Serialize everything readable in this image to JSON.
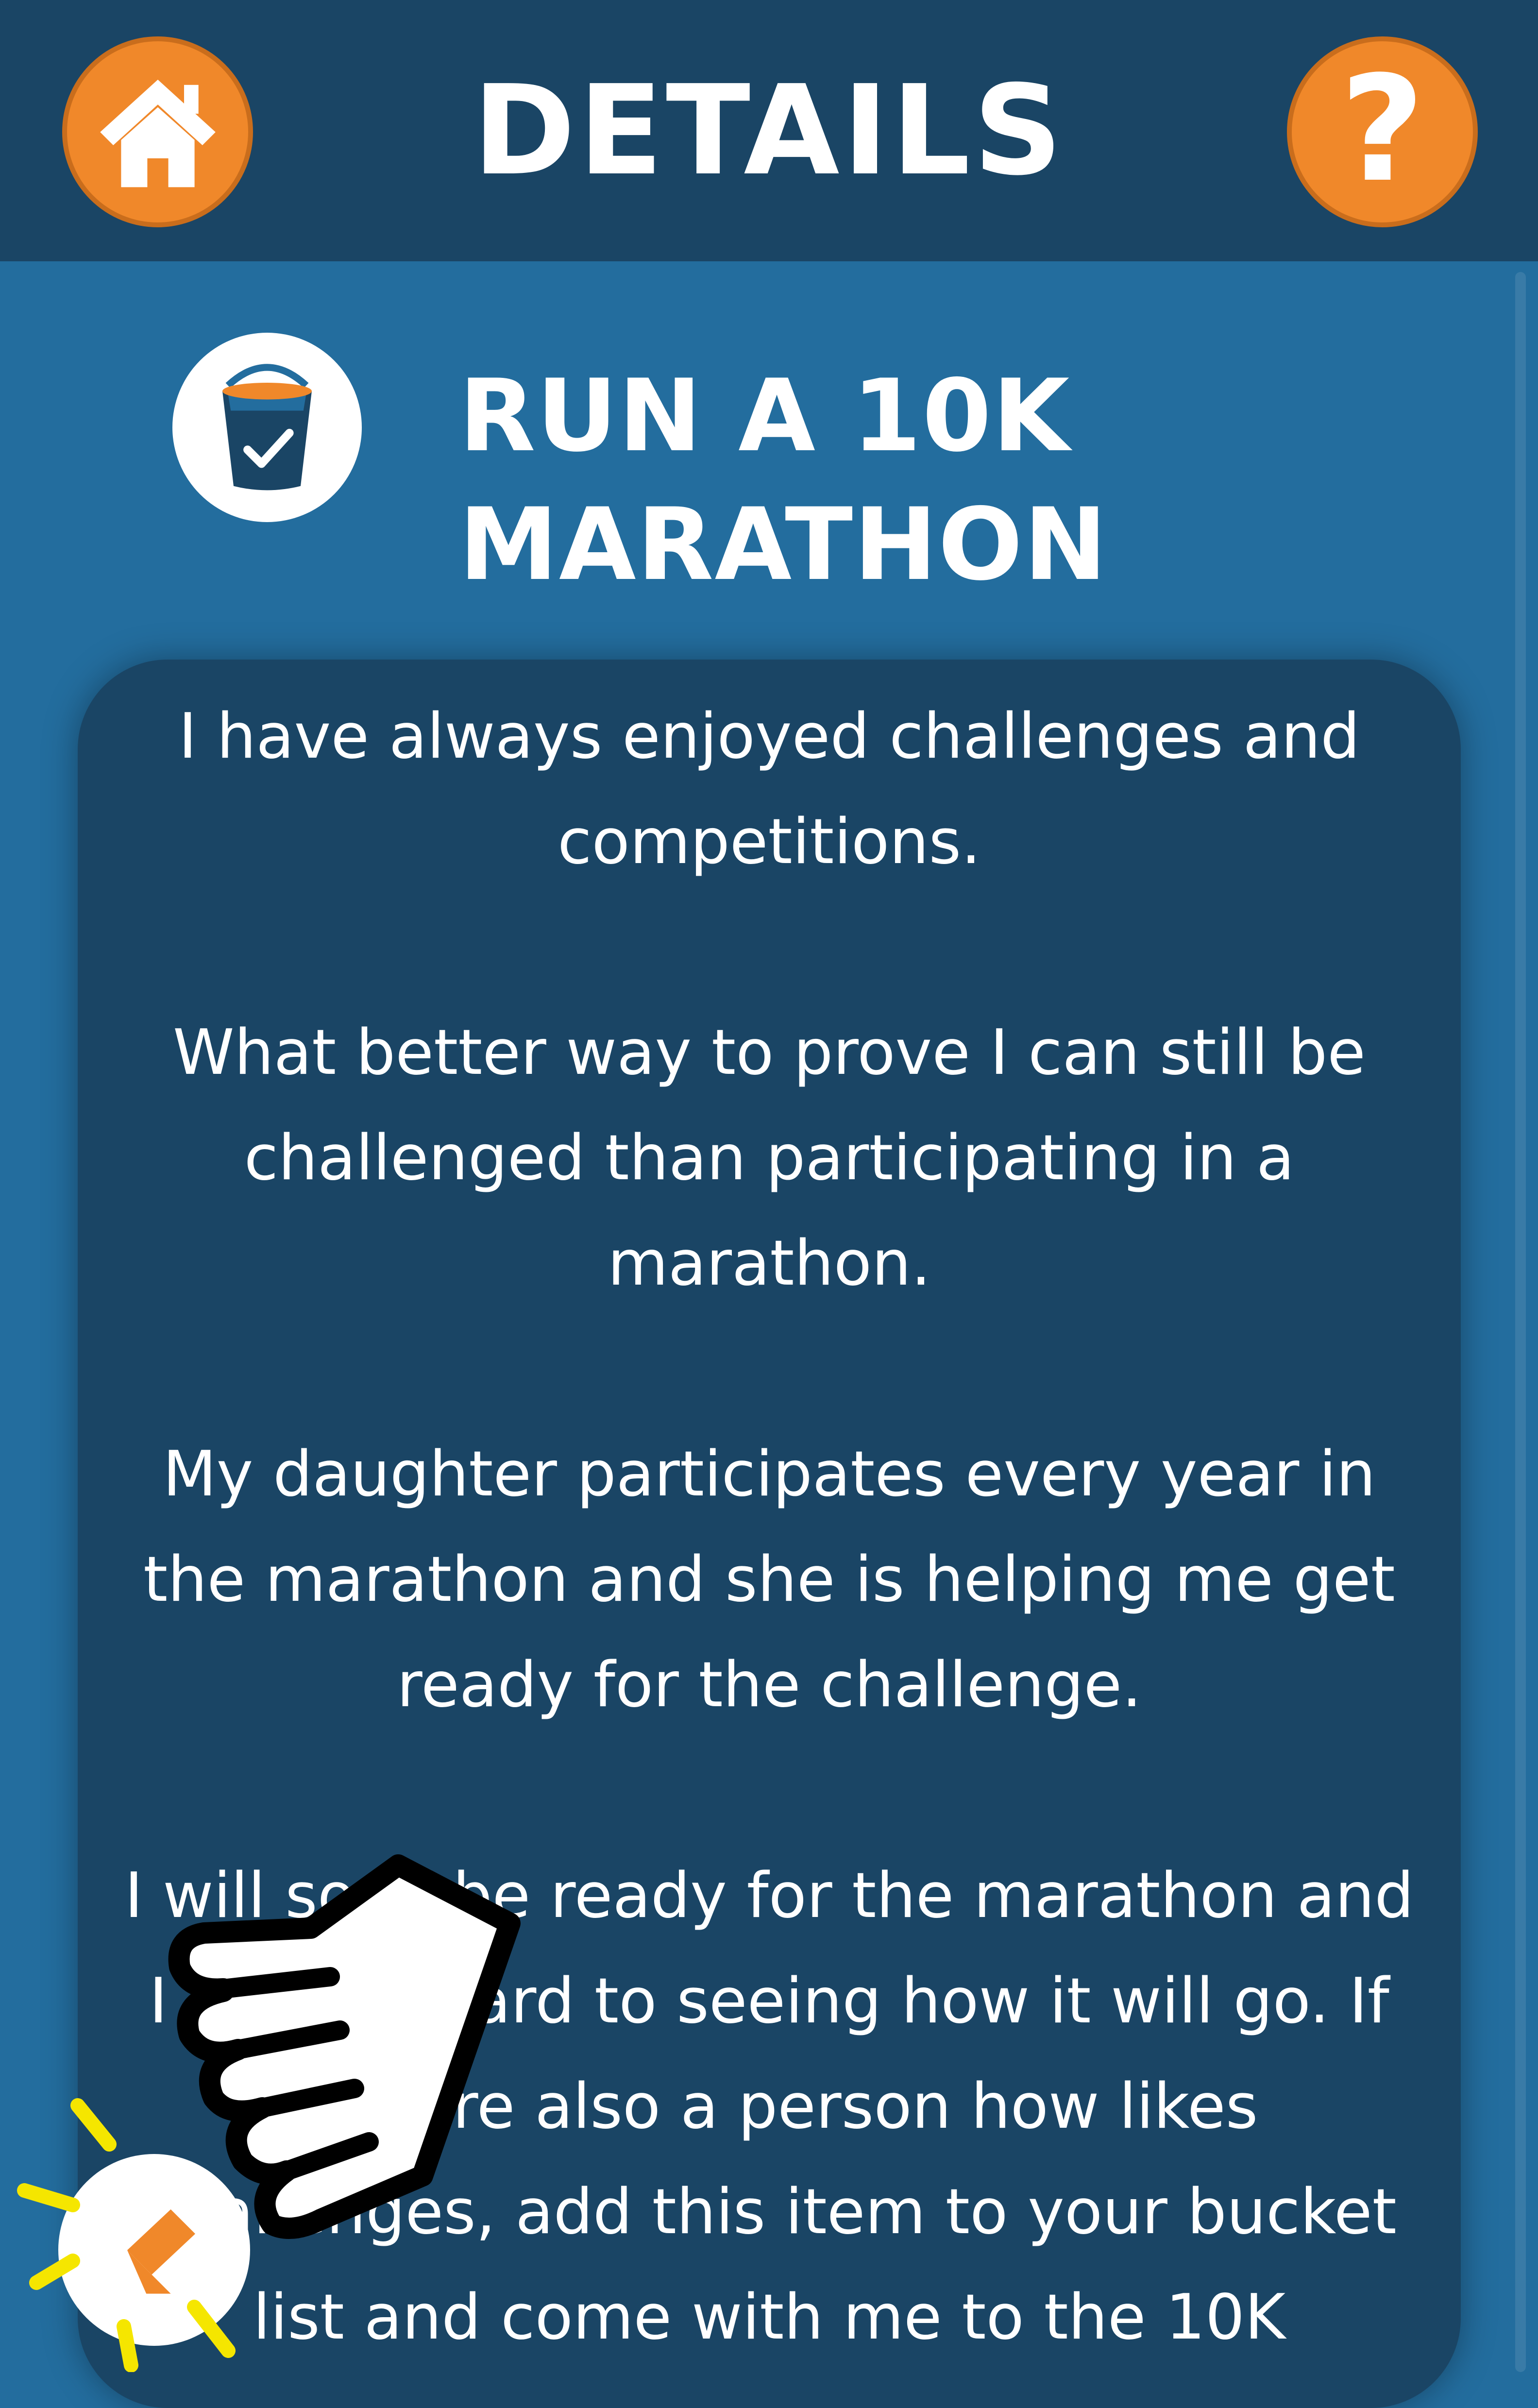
{
  "header": {
    "title": "DETAILS",
    "home_icon": "home-icon",
    "help_icon": "question-icon",
    "help_glyph": "?"
  },
  "item": {
    "icon": "bucket-check-icon",
    "title": "RUN A 10K MARATHON",
    "description": "I have always enjoyed challenges and competitions.\n\nWhat better way to prove I can still be challenged than participating in a marathon.\n\nMy daughter participates every year in the marathon and she is helping me get ready for the challenge.\n\nI will soon be ready for the marathon and I look forward to seeing how it will go. If you are also a person how likes challenges, add this item to your bucket list and come with me to the 10K"
  },
  "floating_button": {
    "icon": "back-arrow-icon"
  },
  "overlay": {
    "pointer_icon": "tap-hand-icon",
    "sparkle_icon": "tap-sparkle-icon"
  },
  "colors": {
    "header_bg": "#1a4565",
    "page_bg": "#236d9e",
    "card_bg": "#1a4565",
    "accent": "#f0882a",
    "sparkle": "#f5e600"
  }
}
